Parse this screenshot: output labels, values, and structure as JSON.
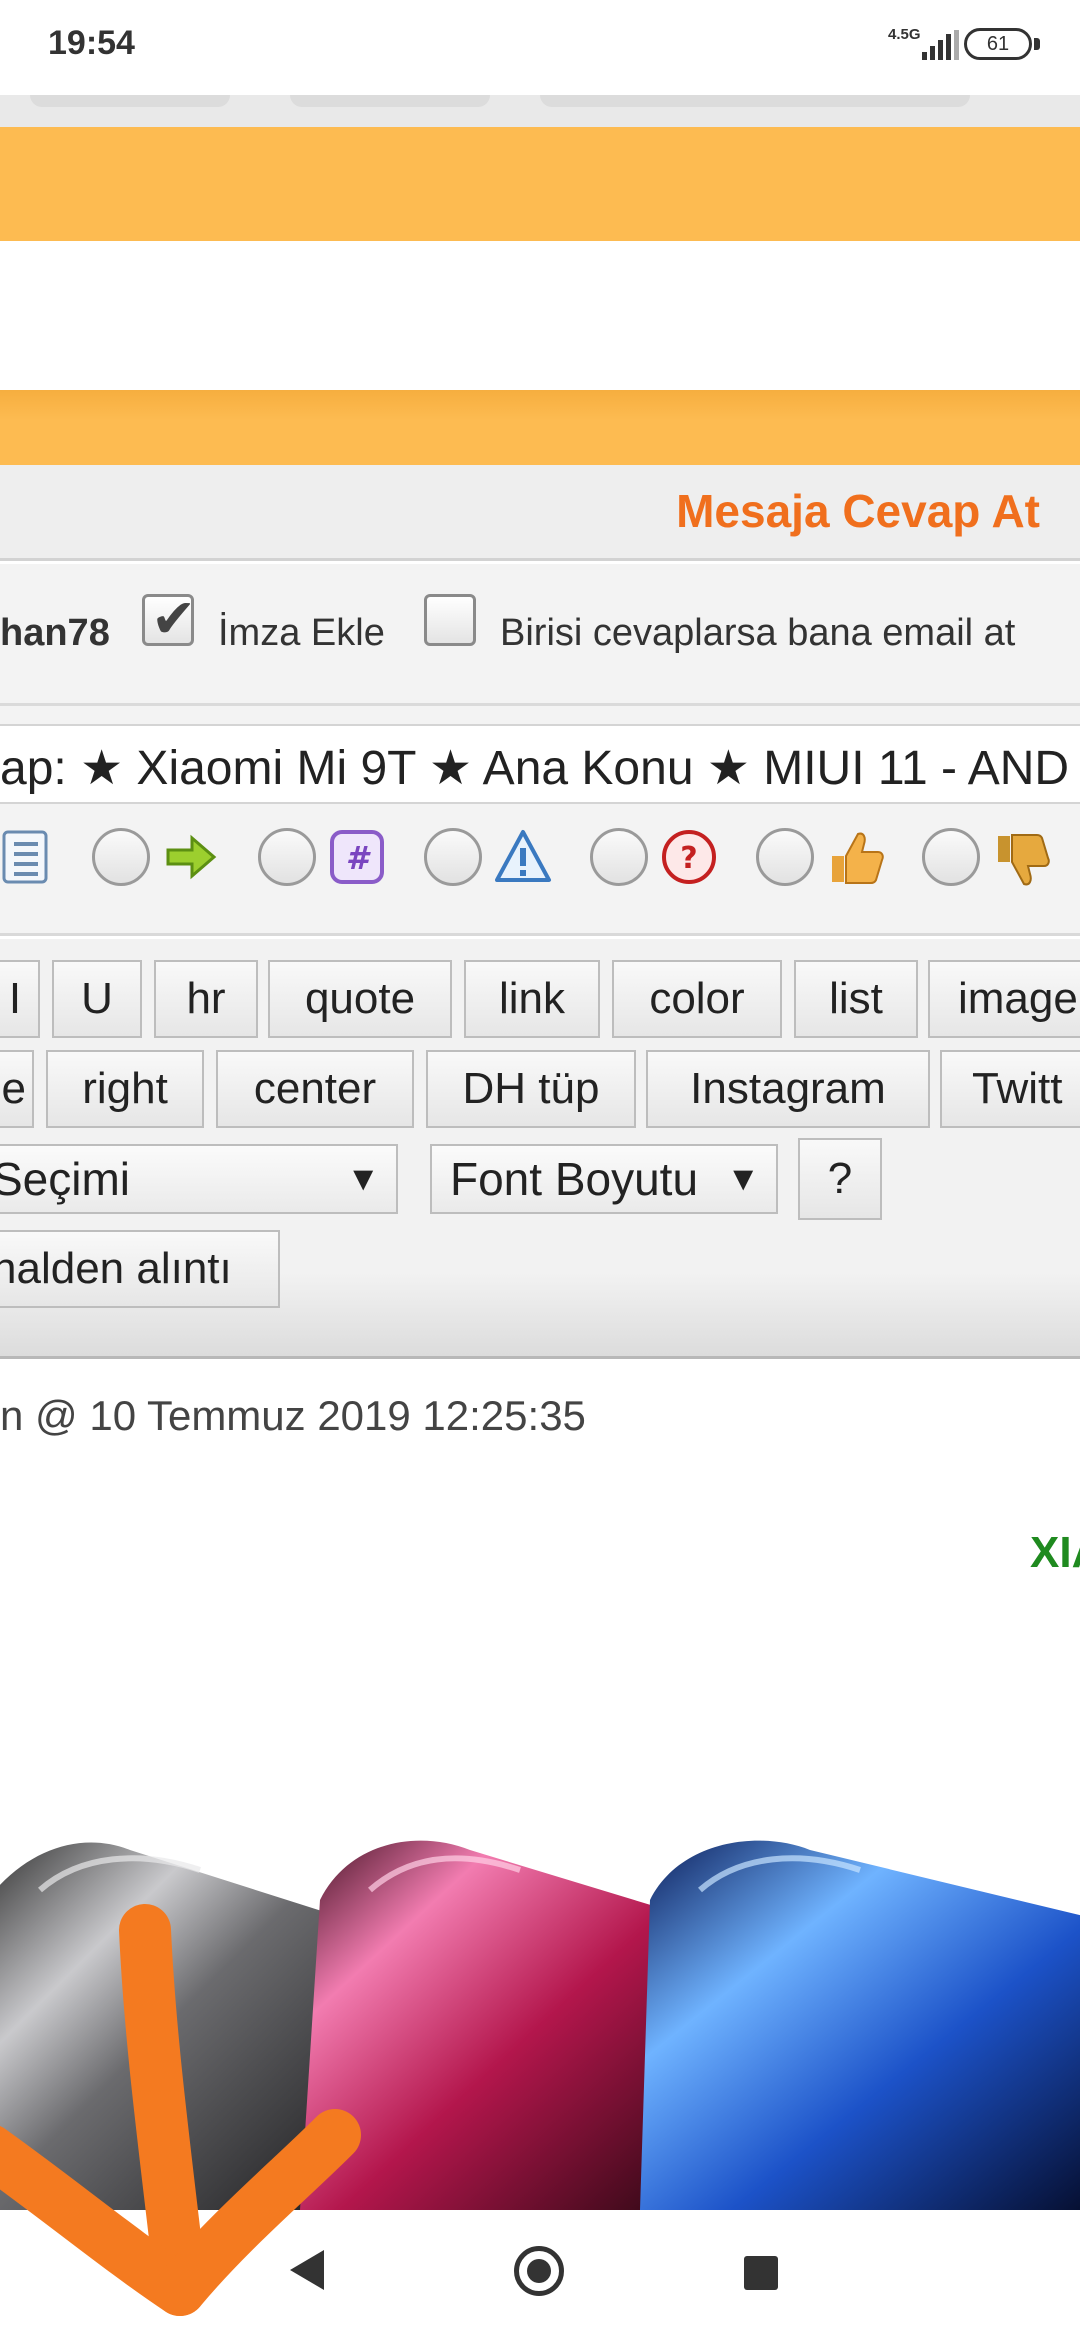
{
  "status_bar": {
    "time": "19:54",
    "network": "4.5G",
    "battery": "61"
  },
  "reply": {
    "title": "Mesaja Cevap At",
    "username": "han78",
    "signature_label": "İmza Ekle",
    "signature_checked": true,
    "notify_label": "Birisi cevaplarsa bana email at",
    "notify_checked": false
  },
  "subject": {
    "value": "ap: ★ Xiaomi Mi 9T ★ Ana Konu ★ MIUI 11 - AND"
  },
  "message_icons": [
    {
      "icon": "list-icon"
    },
    {
      "icon": "arrow-right-icon"
    },
    {
      "icon": "hash-icon"
    },
    {
      "icon": "warning-icon"
    },
    {
      "icon": "question-icon"
    },
    {
      "icon": "thumbs-up-icon"
    },
    {
      "icon": "thumbs-down-icon"
    }
  ],
  "toolbar": {
    "row1": [
      "I",
      "U",
      "hr",
      "quote",
      "link",
      "color",
      "list",
      "image"
    ],
    "row2": [
      "e",
      "right",
      "center",
      "DH tüp",
      "Instagram",
      "Twitt"
    ],
    "font_select": "Seçimi",
    "size_select": "Font Boyutu",
    "help": "?",
    "quote_selected": "nalden alıntı"
  },
  "post": {
    "date_line": "n @ 10 Temmuz 2019 12:25:35",
    "banner_text": "XIA"
  },
  "colors": {
    "orange_bar": "#fdbb51",
    "title_orange": "#f06f1d",
    "green_text": "#1f8a1f",
    "annotation": "#f47a20"
  }
}
